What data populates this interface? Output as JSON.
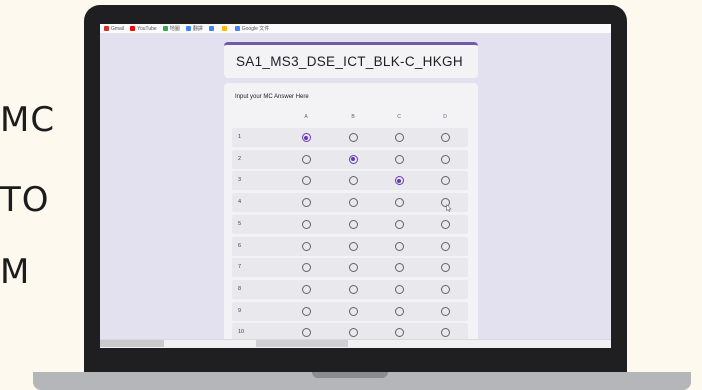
{
  "side_text": {
    "line1": "MC",
    "line2": "TO",
    "line3": "M"
  },
  "bookmarks": [
    {
      "label": "Gmail",
      "color": "#d93025"
    },
    {
      "label": "YouTube",
      "color": "#ff0000"
    },
    {
      "label": "地圖",
      "color": "#34a853"
    },
    {
      "label": "翻譯",
      "color": "#4285f4"
    },
    {
      "label": "",
      "color": "#4285f4"
    },
    {
      "label": "",
      "color": "#fbbc04"
    },
    {
      "label": "Google 文件",
      "color": "#4285f4"
    }
  ],
  "form": {
    "title": "SA1_MS3_DSE_ICT_BLK-C_HKGH",
    "accent_color": "#673ab7",
    "question": "Input your MC Answer Here",
    "columns": [
      "A",
      "B",
      "C",
      "D"
    ],
    "rows": [
      {
        "label": "1",
        "selected": "A"
      },
      {
        "label": "2",
        "selected": "B"
      },
      {
        "label": "3",
        "selected": "C"
      },
      {
        "label": "4",
        "selected": null
      },
      {
        "label": "5",
        "selected": null
      },
      {
        "label": "6",
        "selected": null
      },
      {
        "label": "7",
        "selected": null
      },
      {
        "label": "8",
        "selected": null
      },
      {
        "label": "9",
        "selected": null
      },
      {
        "label": "10",
        "selected": null
      }
    ]
  }
}
